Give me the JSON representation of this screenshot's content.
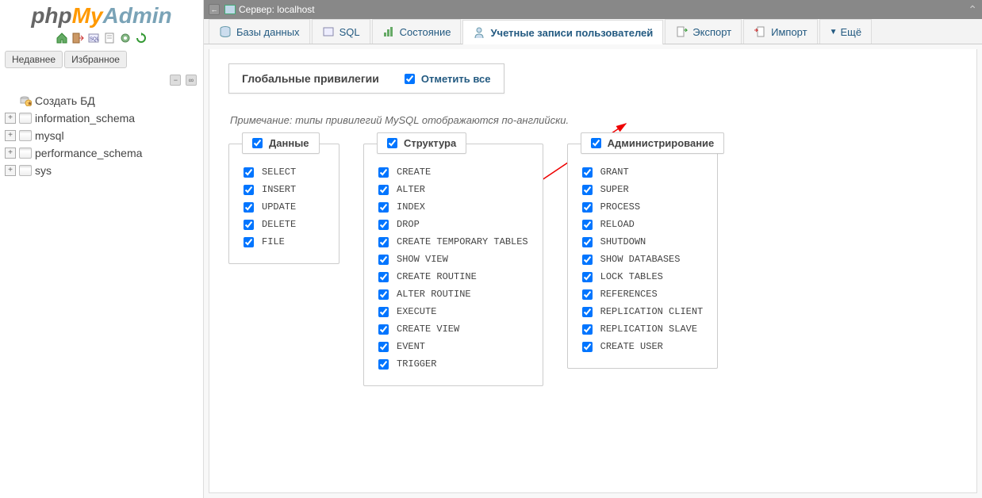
{
  "logo": {
    "p1": "php",
    "p2": "My",
    "p3": "Admin"
  },
  "sidebar": {
    "tabs": {
      "recent": "Недавнее",
      "favorites": "Избранное"
    },
    "create_db": "Создать БД",
    "databases": [
      {
        "name": "information_schema"
      },
      {
        "name": "mysql"
      },
      {
        "name": "performance_schema"
      },
      {
        "name": "sys"
      }
    ]
  },
  "topbar": {
    "server_label": "Сервер: localhost"
  },
  "main_tabs": {
    "databases": "Базы данных",
    "sql": "SQL",
    "status": "Состояние",
    "users": "Учетные записи пользователей",
    "export": "Экспорт",
    "import": "Импорт",
    "more": "Ещё"
  },
  "global_privs": {
    "title": "Глобальные привилегии",
    "check_all": "Отметить все"
  },
  "note": "Примечание: типы привилегий MySQL отображаются по-английски.",
  "priv_groups": [
    {
      "title": "Данные",
      "items": [
        "SELECT",
        "INSERT",
        "UPDATE",
        "DELETE",
        "FILE"
      ]
    },
    {
      "title": "Структура",
      "items": [
        "CREATE",
        "ALTER",
        "INDEX",
        "DROP",
        "CREATE TEMPORARY TABLES",
        "SHOW VIEW",
        "CREATE ROUTINE",
        "ALTER ROUTINE",
        "EXECUTE",
        "CREATE VIEW",
        "EVENT",
        "TRIGGER"
      ]
    },
    {
      "title": "Администрирование",
      "items": [
        "GRANT",
        "SUPER",
        "PROCESS",
        "RELOAD",
        "SHUTDOWN",
        "SHOW DATABASES",
        "LOCK TABLES",
        "REFERENCES",
        "REPLICATION CLIENT",
        "REPLICATION SLAVE",
        "CREATE USER"
      ]
    }
  ]
}
